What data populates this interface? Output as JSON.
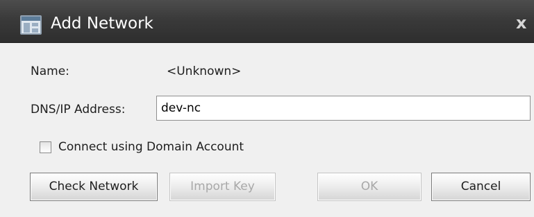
{
  "window": {
    "title": "Add Network",
    "close_glyph": "x",
    "icon": "network-app-icon"
  },
  "form": {
    "name_label": "Name:",
    "name_value": "<Unknown>",
    "dns_label": "DNS/IP Address:",
    "dns_value": "dev-nc",
    "domain_checkbox_label": "Connect using Domain Account",
    "domain_checkbox_checked": false
  },
  "buttons": {
    "check_network": "Check Network",
    "import_key": "Import Key",
    "ok": "OK",
    "cancel": "Cancel"
  },
  "colors": {
    "titlebar": "#3a3a3a",
    "dialog_background": "#f0f0f0"
  }
}
